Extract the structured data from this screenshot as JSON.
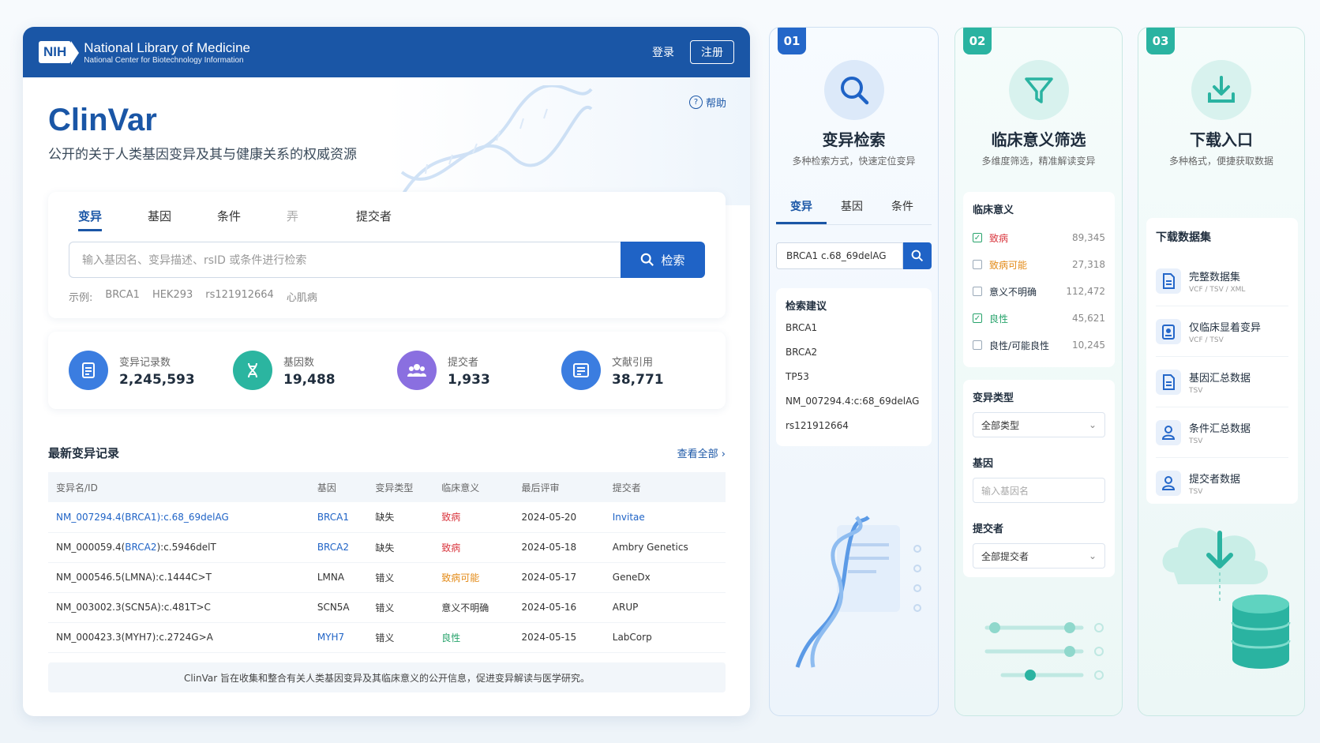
{
  "header": {
    "org_title": "National Library of Medicine",
    "org_subtitle": "National Center for Biotechnology Information",
    "logo_text": "NIH",
    "login": "登录",
    "register": "注册"
  },
  "hero": {
    "title": "ClinVar",
    "subtitle": "公开的关于人类基因变异及其与健康关系的权威资源",
    "help": "帮助"
  },
  "search": {
    "tabs": [
      "变异",
      "基因",
      "条件",
      "弄",
      "提交者"
    ],
    "placeholder": "输入基因名、变异描述、rsID 或条件进行检索",
    "button": "检索",
    "examples_label": "示例:",
    "examples": [
      "BRCA1",
      "HEK293",
      "rs121912664",
      "心肌病"
    ]
  },
  "stats": [
    {
      "label": "变异记录数",
      "value": "2,245,593",
      "color": "#3b7de0",
      "icon": "document-icon"
    },
    {
      "label": "基因数",
      "value": "19,488",
      "color": "#2bb5a0",
      "icon": "dna-icon"
    },
    {
      "label": "提交者",
      "value": "1,933",
      "color": "#8a6fe0",
      "icon": "users-icon"
    },
    {
      "label": "文献引用",
      "value": "38,771",
      "color": "#3b7de0",
      "icon": "book-icon"
    }
  ],
  "recent": {
    "title": "最新变异记录",
    "view_all": "查看全部 ›",
    "columns": [
      "变异名/ID",
      "基因",
      "变异类型",
      "临床意义",
      "最后评审",
      "提交者"
    ],
    "rows": [
      {
        "id": "NM_007294.4(BRCA1):c.68_69delAG",
        "gene": "BRCA1",
        "type": "缺失",
        "sig": "致病",
        "date": "2024-05-20",
        "submitter": "Invitae"
      },
      {
        "id": "NM_000059.4(BRCA2):c.5946delT",
        "gene": "BRCA2",
        "type": "缺失",
        "sig": "致病",
        "date": "2024-05-18",
        "submitter": "Ambry Genetics"
      },
      {
        "id": "NM_000546.5(LMNA):c.1444C>T",
        "gene": "LMNA",
        "type": "错义",
        "sig": "致病可能",
        "date": "2024-05-17",
        "submitter": "GeneDx"
      },
      {
        "id": "NM_003002.3(SCN5A):c.481T>C",
        "gene": "SCN5A",
        "type": "错义",
        "sig": "意义不明确",
        "date": "2024-05-16",
        "submitter": "ARUP"
      },
      {
        "id": "NM_000423.3(MYH7):c.2724G>A",
        "gene": "MYH7",
        "type": "错义",
        "sig": "良性",
        "date": "2024-05-15",
        "submitter": "LabCorp"
      }
    ]
  },
  "footer_note": "ClinVar 旨在收集和整合有关人类基因变异及其临床意义的公开信息，促进变异解读与医学研究。",
  "card1": {
    "badge": "01",
    "title": "变异检索",
    "subtitle": "多种检索方式，快速定位变异",
    "tabs": [
      "变异",
      "基因",
      "条件"
    ],
    "search_value": "BRCA1 c.68_69delAG",
    "suggest_title": "检索建议",
    "suggestions": [
      "BRCA1",
      "BRCA2",
      "TP53",
      "NM_007294.4:c:68_69delAG",
      "rs121912664"
    ]
  },
  "card2": {
    "badge": "02",
    "title": "临床意义筛选",
    "subtitle": "多维度筛选，精准解读变异",
    "sig_title": "临床意义",
    "sig_items": [
      {
        "label": "致病",
        "count": "89,345",
        "checked": true,
        "color": "#d9363e"
      },
      {
        "label": "致病可能",
        "count": "27,318",
        "checked": false,
        "color": "#e38a17"
      },
      {
        "label": "意义不明确",
        "count": "112,472",
        "checked": false,
        "color": "#333333"
      },
      {
        "label": "良性",
        "count": "45,621",
        "checked": true,
        "color": "#27a36b"
      },
      {
        "label": "良性/可能良性",
        "count": "10,245",
        "checked": false,
        "color": "#333333"
      }
    ],
    "type_title": "变异类型",
    "type_value": "全部类型",
    "gene_title": "基因",
    "gene_placeholder": "输入基因名",
    "submitter_title": "提交者",
    "submitter_value": "全部提交者"
  },
  "card3": {
    "badge": "03",
    "title": "下载入口",
    "subtitle": "多种格式，便捷获取数据",
    "list_title": "下载数据集",
    "items": [
      {
        "name": "完整数据集",
        "formats": "VCF / TSV / XML"
      },
      {
        "name": "仅临床显着变异",
        "formats": "VCF / TSV"
      },
      {
        "name": "基因汇总数据",
        "formats": "TSV"
      },
      {
        "name": "条件汇总数据",
        "formats": "TSV"
      },
      {
        "name": "提交者数据",
        "formats": "TSV"
      }
    ]
  }
}
